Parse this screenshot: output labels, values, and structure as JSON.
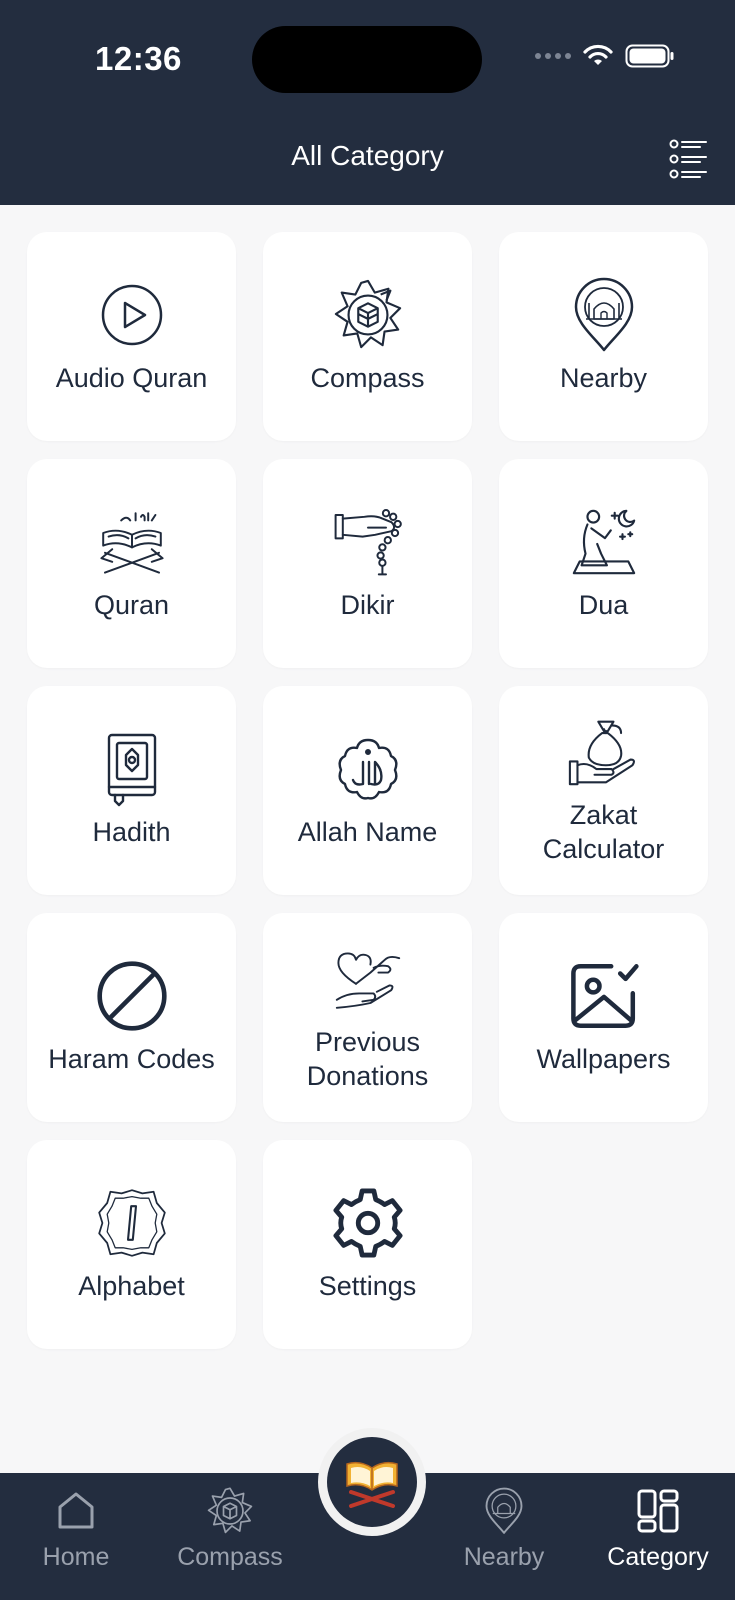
{
  "status": {
    "time": "12:36"
  },
  "header": {
    "title": "All Category",
    "menu_icon": "list-menu-icon"
  },
  "tiles": [
    {
      "label": "Audio Quran",
      "icon": "play-circle-icon"
    },
    {
      "label": "Compass",
      "icon": "compass-kaaba-icon"
    },
    {
      "label": "Nearby",
      "icon": "mosque-pin-icon"
    },
    {
      "label": "Quran",
      "icon": "quran-book-icon"
    },
    {
      "label": "Dikir",
      "icon": "prayer-beads-icon"
    },
    {
      "label": "Dua",
      "icon": "praying-person-icon"
    },
    {
      "label": "Hadith",
      "icon": "hadith-book-icon"
    },
    {
      "label": "Allah Name",
      "icon": "allah-calligraphy-icon"
    },
    {
      "label": "Zakat Calculator",
      "icon": "money-bag-hand-icon"
    },
    {
      "label": "Haram Codes",
      "icon": "prohibited-icon"
    },
    {
      "label": "Previous Donations",
      "icon": "heart-hand-icon"
    },
    {
      "label": "Wallpapers",
      "icon": "image-check-icon"
    },
    {
      "label": "Alphabet",
      "icon": "arabic-alif-icon"
    },
    {
      "label": "Settings",
      "icon": "gear-icon"
    }
  ],
  "bottom_nav": {
    "items": [
      {
        "label": "Home",
        "icon": "home-icon"
      },
      {
        "label": "Compass",
        "icon": "compass-kaaba-icon"
      },
      {
        "label": "Nearby",
        "icon": "mosque-pin-icon"
      },
      {
        "label": "Category",
        "icon": "category-grid-icon"
      }
    ],
    "center_icon": "quran-book-icon"
  },
  "colors": {
    "header_bg": "#232d3f",
    "icon": "#1f2a3c",
    "page_bg": "#f7f7f8"
  }
}
